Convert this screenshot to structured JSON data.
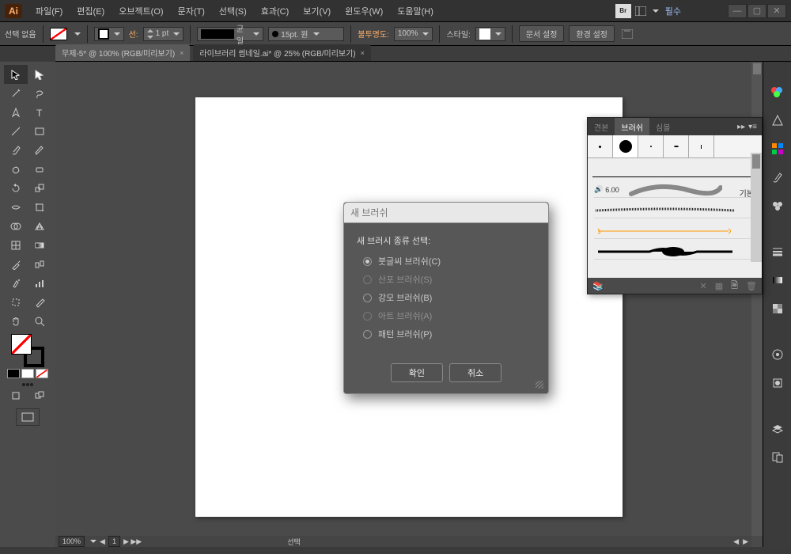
{
  "app": {
    "name": "Ai"
  },
  "menu": [
    "파일(F)",
    "편집(E)",
    "오브젝트(O)",
    "문자(T)",
    "선택(S)",
    "효과(C)",
    "보기(V)",
    "윈도우(W)",
    "도움말(H)"
  ],
  "workspace": "필수",
  "ctrl": {
    "selection": "선택 없음",
    "strokeLabel": "선:",
    "strokeWeight": "1 pt",
    "dash": "균일",
    "tip": "15pt. 원",
    "opacityLabel": "불투명도:",
    "opacity": "100%",
    "styleLabel": "스타일:",
    "docSetup": "문서 설정",
    "prefSetup": "환경 설정"
  },
  "tabs": [
    "무제-5* @ 100% (RGB/미리보기)",
    "라이브러리 썸네일.ai* @ 25% (RGB/미리보기)"
  ],
  "status": {
    "zoom": "100%",
    "page": "1",
    "tool": "선택"
  },
  "brushPanel": {
    "tabs": [
      "견본",
      "브러쉬",
      "심볼"
    ],
    "basic": "기본",
    "sample": "6.00"
  },
  "dialog": {
    "title": "새 브러쉬",
    "heading": "새 브러시 종류 선택:",
    "options": [
      {
        "label": "붓글씨 브러쉬(C)",
        "sel": true,
        "en": true
      },
      {
        "label": "산포 브러쉬(S)",
        "sel": false,
        "en": false
      },
      {
        "label": "강모 브러쉬(B)",
        "sel": false,
        "en": true
      },
      {
        "label": "아트 브러쉬(A)",
        "sel": false,
        "en": false
      },
      {
        "label": "패턴 브러쉬(P)",
        "sel": false,
        "en": true
      }
    ],
    "ok": "확인",
    "cancel": "취소"
  }
}
